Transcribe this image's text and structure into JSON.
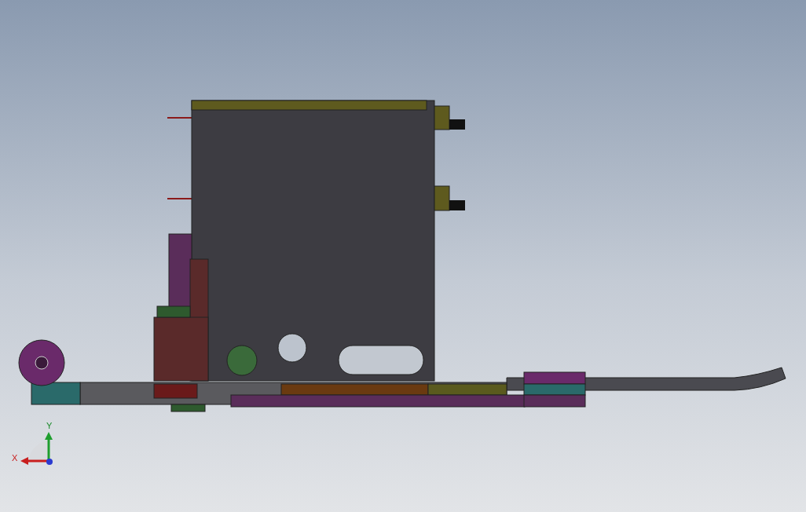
{
  "triad": {
    "axes": [
      {
        "kind": "y",
        "label": "Y"
      },
      {
        "kind": "x",
        "label": "X"
      }
    ]
  }
}
